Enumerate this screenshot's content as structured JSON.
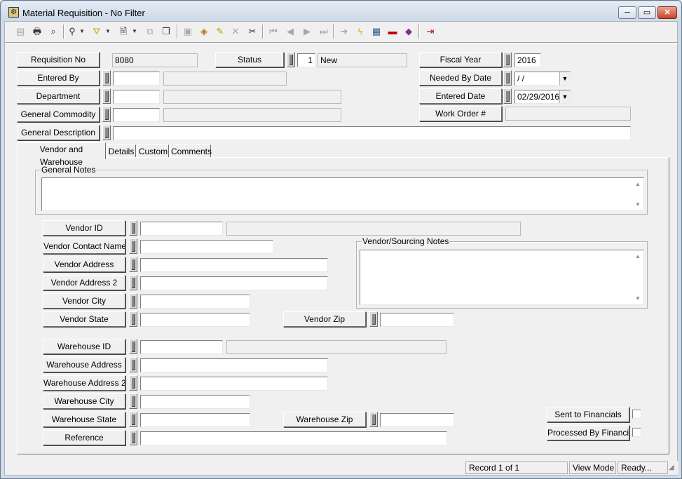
{
  "window": {
    "title": "Material Requisition - No Filter",
    "minimize": "─",
    "restore": "▭",
    "close": "✕"
  },
  "toolbar": {
    "icons": [
      "first-record-icon",
      "print-icon",
      "print-preview-icon",
      "binoculars-icon",
      "filter-icon",
      "new-document-icon",
      "copy-icon",
      "copy-to-icon",
      "save-icon",
      "layers-icon",
      "edit-pencil-icon",
      "delete-icon",
      "cut-icon",
      "first-icon",
      "previous-icon",
      "next-icon",
      "last-icon",
      "goto-icon",
      "lightning-icon",
      "image-icon",
      "toolbox-icon",
      "book-icon",
      "exit-icon"
    ]
  },
  "header": {
    "requisition_no": {
      "label": "Requisition No",
      "value": "8080"
    },
    "status": {
      "label": "Status",
      "code": "1",
      "value": "New"
    },
    "fiscal_year": {
      "label": "Fiscal Year",
      "value": "2016"
    },
    "entered_by": {
      "label": "Entered By",
      "value": "",
      "desc": ""
    },
    "needed_by_date": {
      "label": "Needed By Date",
      "value": " /  /"
    },
    "department": {
      "label": "Department",
      "value": "",
      "desc": ""
    },
    "entered_date": {
      "label": "Entered Date",
      "value": "02/29/2016"
    },
    "general_commodity": {
      "label": "General Commodity",
      "value": "",
      "desc": ""
    },
    "work_order": {
      "label": "Work Order #",
      "value": ""
    },
    "general_description": {
      "label": "General Description",
      "value": ""
    }
  },
  "tabs": [
    {
      "label": "Vendor and Warehouse",
      "active": true
    },
    {
      "label": "Details",
      "active": false
    },
    {
      "label": "Custom",
      "active": false
    },
    {
      "label": "Comments",
      "active": false
    }
  ],
  "vendor_tab": {
    "general_notes_label": "General Notes",
    "general_notes_value": "",
    "vendor_id": {
      "label": "Vendor ID",
      "value": "",
      "desc": ""
    },
    "vendor_contact_name": {
      "label": "Vendor Contact Name",
      "value": ""
    },
    "vendor_sourcing_notes_label": "Vendor/Sourcing Notes",
    "vendor_address": {
      "label": "Vendor Address",
      "value": ""
    },
    "vendor_address_2": {
      "label": "Vendor Address 2",
      "value": ""
    },
    "vendor_city": {
      "label": "Vendor City",
      "value": ""
    },
    "vendor_state": {
      "label": "Vendor State",
      "value": ""
    },
    "vendor_zip": {
      "label": "Vendor Zip",
      "value": ""
    },
    "warehouse_id": {
      "label": "Warehouse ID",
      "value": "",
      "desc": ""
    },
    "warehouse_address": {
      "label": "Warehouse  Address",
      "value": ""
    },
    "warehouse_address_2": {
      "label": "Warehouse  Address 2",
      "value": ""
    },
    "warehouse_city": {
      "label": "Warehouse  City",
      "value": ""
    },
    "warehouse_state": {
      "label": "Warehouse  State",
      "value": ""
    },
    "warehouse_zip": {
      "label": "Warehouse  Zip",
      "value": ""
    },
    "reference": {
      "label": "Reference",
      "value": ""
    },
    "sent_to_financials": {
      "label": "Sent to Financials",
      "checked": false
    },
    "processed_by_financials": {
      "label": "Processed By Financials",
      "checked": false
    }
  },
  "statusbar": {
    "record": "Record 1 of 1",
    "mode": "View Mode",
    "state": "Ready..."
  }
}
